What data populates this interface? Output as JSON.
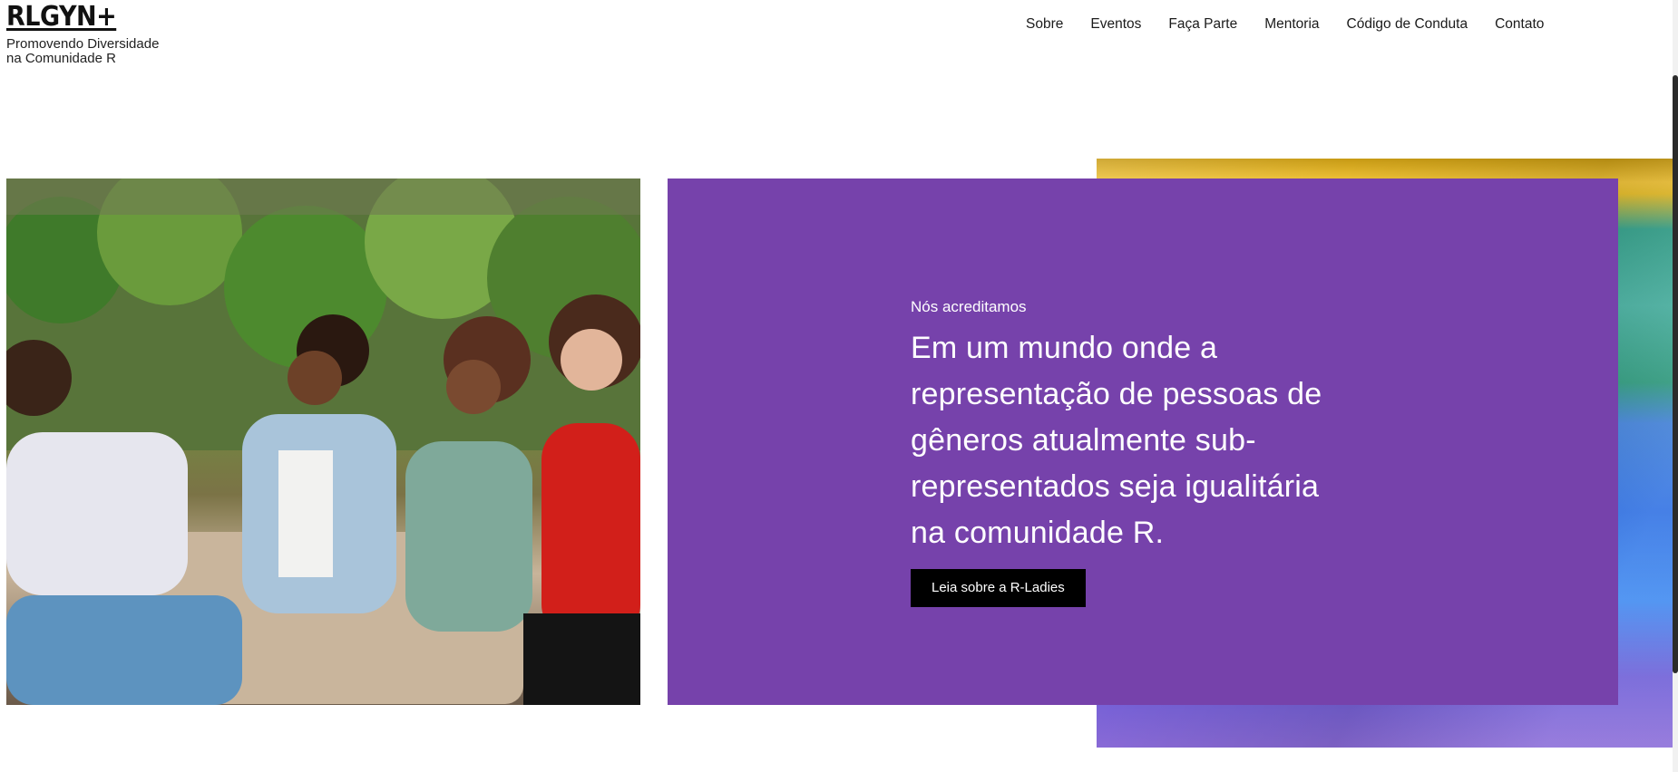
{
  "brand": {
    "logo": "RLGYN+",
    "tagline_line1": "Promovendo Diversidade",
    "tagline_line2": "na Comunidade R"
  },
  "nav": {
    "items": [
      "Sobre",
      "Eventos",
      "Faça Parte",
      "Mentoria",
      "Código de Conduta",
      "Contato"
    ]
  },
  "hero": {
    "eyebrow": "Nós acreditamos",
    "headline": "Em um mundo onde a representação de pessoas de gêneros atualmente sub-representados seja igualitária na comunidade R.",
    "cta_label": "Leia sobre a R-Ladies",
    "panel_color": "#7642ab"
  }
}
